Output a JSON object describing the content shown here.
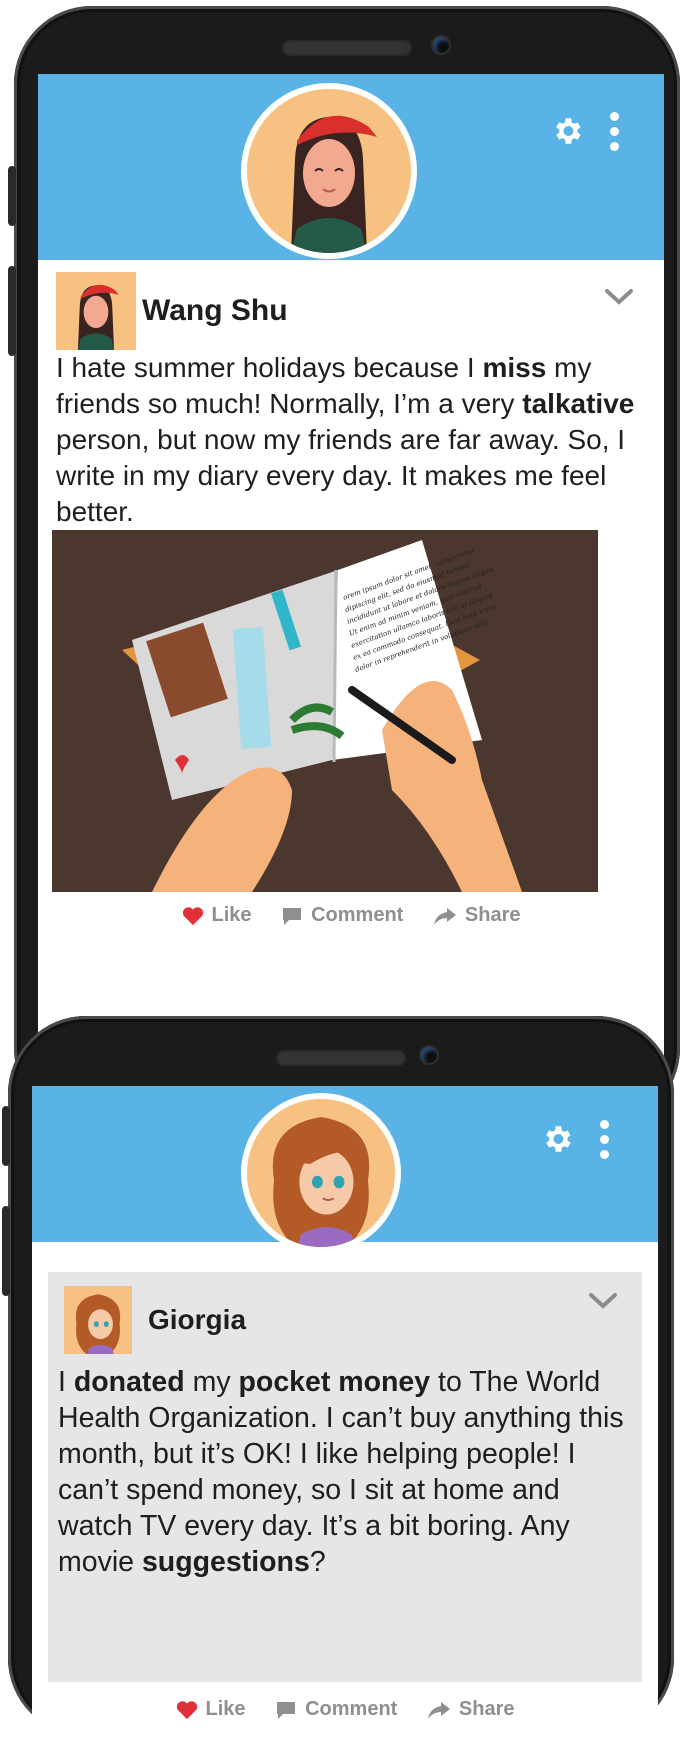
{
  "posts": [
    {
      "author": "Wang Shu",
      "text_parts": [
        "I hate summer holidays because I ",
        "miss",
        " my friends so much! Normally, I’m a very ",
        "talkative",
        " person, but now my friends are far away. So, I write in my diary every day. It makes me feel better."
      ],
      "image_text": "orem ipsum dolor sit amet, consectetur dipiscing elit, sed do eiusmod tempor incididunt ut labore et dolore magna aliqua. Ut enim ad minim veniam, quis nostrud exercitation ullamco laboris nisi ut aliquip ex ea commodo consequat. Duis aute irure dolor in reprehenderit in voluptate velit",
      "actions": {
        "like": "Like",
        "comment": "Comment",
        "share": "Share"
      }
    },
    {
      "author": "Giorgia",
      "text_parts": [
        "I ",
        "donated",
        " my ",
        "pocket money",
        " to The World Health Organization. I can’t buy anything this month, but it’s OK! I like helping people! I can’t spend money, so I sit at home and watch TV every day. It’s a bit boring. Any movie ",
        "suggestions",
        "?"
      ],
      "actions": {
        "like": "Like",
        "comment": "Comment",
        "share": "Share"
      }
    }
  ],
  "colors": {
    "banner": "#5ab3e6",
    "like_heart": "#e0303a",
    "action_text": "#8f8f8f",
    "diary_bg": "#4b372d"
  },
  "icons": [
    "gear-icon",
    "kebab-menu-icon",
    "chevron-down-icon",
    "heart-icon",
    "comment-icon",
    "share-arrow-icon"
  ]
}
